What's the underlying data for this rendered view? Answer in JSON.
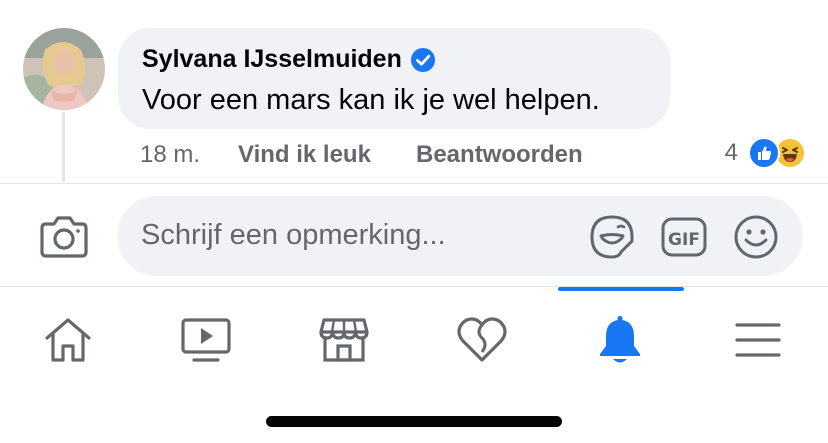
{
  "comment": {
    "author": "Sylvana IJsselmuiden",
    "verified": true,
    "text": "Voor een mars kan ik je wel helpen.",
    "time": "18 m.",
    "like_label": "Vind ik leuk",
    "reply_label": "Beantwoorden",
    "reaction_count": "4",
    "reactions": [
      "like-icon",
      "haha-icon"
    ]
  },
  "composer": {
    "placeholder": "Schrijf een opmerking...",
    "icons": [
      "camera-icon",
      "sticker-icon",
      "gif-icon",
      "emoji-icon"
    ],
    "gif_label": "GIF"
  },
  "tabbar": {
    "tabs": [
      "home",
      "watch",
      "marketplace",
      "dating",
      "notifications",
      "menu"
    ],
    "active": "notifications"
  },
  "colors": {
    "accent": "#1877f2",
    "bubble": "#f0f2f5",
    "secondary_text": "#65676b",
    "haha": "#f7c23a"
  }
}
